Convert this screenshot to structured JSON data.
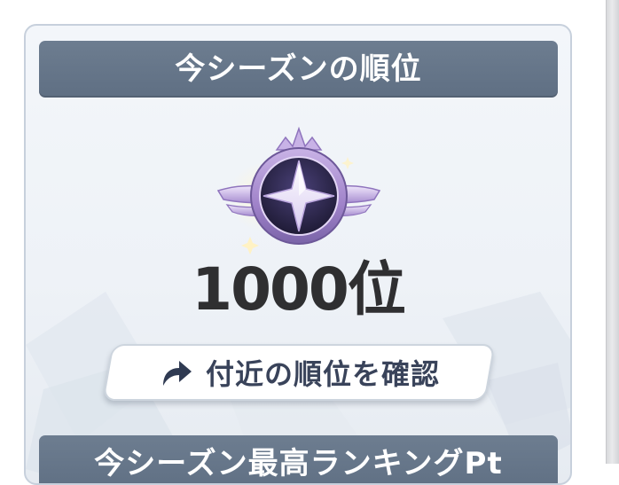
{
  "season_rank": {
    "header_title": "今シーズンの順位",
    "rank_value": "1000位",
    "nearby_button_label": "付近の順位を確認",
    "nearby_button_icon": "arrow-curve-icon",
    "next_section_title": "今シーズン最高ランキングPt"
  },
  "colors": {
    "header_bg": "#66778a",
    "rank_text": "#2f2f31",
    "button_text": "#39435a",
    "emblem_purple": "#b79ad8",
    "emblem_core": "#2a2547"
  }
}
